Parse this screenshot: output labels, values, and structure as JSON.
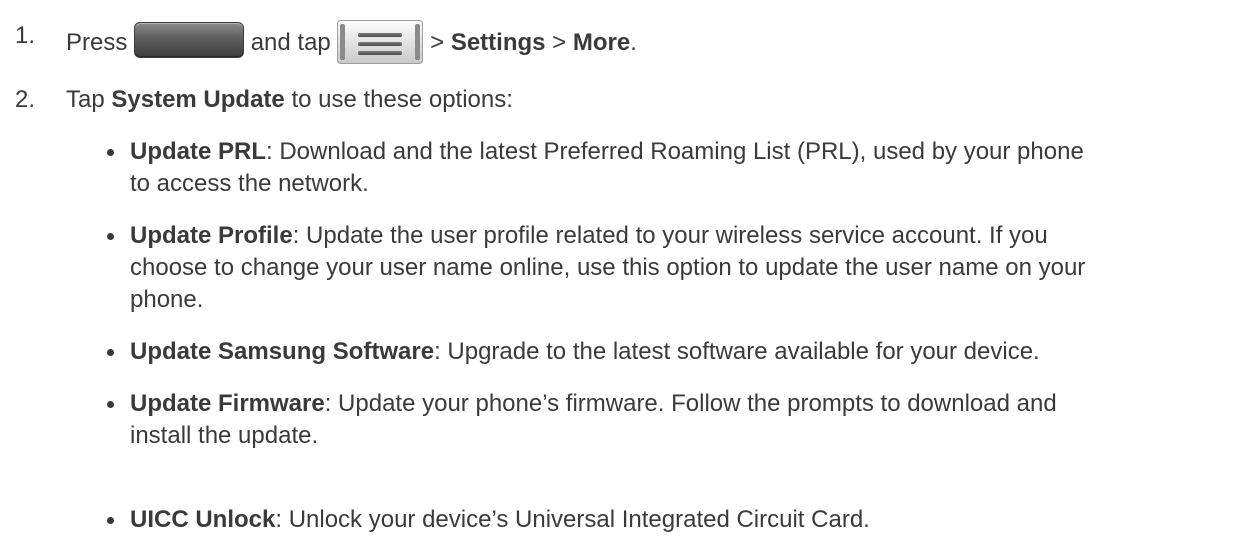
{
  "step1": {
    "number": "1.",
    "press": "Press",
    "and_tap": "and tap",
    "sep1": ">",
    "settings": "Settings",
    "sep2": ">",
    "more": "More",
    "end": "."
  },
  "step2": {
    "number": "2.",
    "tap": "Tap",
    "system_update": "System Update",
    "rest": "to use these options:"
  },
  "options": [
    {
      "term": "Update PRL",
      "desc": ": Download and the latest Preferred Roaming List (PRL), used by your phone",
      "desc2": "to access the network."
    },
    {
      "term": "Update Profile",
      "desc": ": Update the user profile related to your wireless service account. If you",
      "desc2": "choose to change your user name online, use this option to update the user name on your",
      "desc3": "phone."
    },
    {
      "term": "Update Samsung Software",
      "desc": ": Upgrade to the latest software available for your device."
    },
    {
      "term": "Update Firmware",
      "desc": ": Update your phone’s firmware. Follow the prompts to download and",
      "desc2": "install the update."
    },
    {
      "term": "UICC Unlock",
      "desc": ": Unlock your device’s Universal Integrated Circuit Card."
    }
  ],
  "icons": {
    "home_key": "home-key-icon",
    "menu_key": "menu-key-icon"
  }
}
